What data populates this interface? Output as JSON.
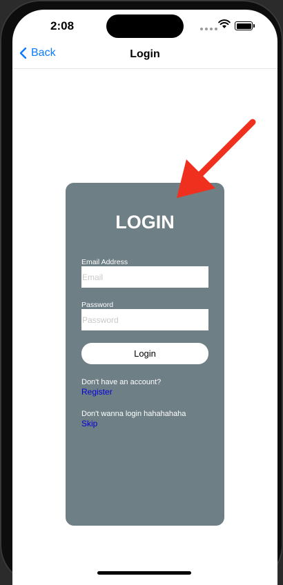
{
  "status_bar": {
    "time": "2:08"
  },
  "nav": {
    "back_label": "Back",
    "title": "Login"
  },
  "card": {
    "title": "LOGIN",
    "email": {
      "label": "Email Address",
      "placeholder": "Email",
      "value": ""
    },
    "password": {
      "label": "Password",
      "placeholder": "Password",
      "value": ""
    },
    "login_button": "Login",
    "register_prompt": "Don't have an account?",
    "register_link": "Register",
    "skip_prompt": "Don't wanna login hahahahaha",
    "skip_link": "Skip"
  },
  "colors": {
    "card_bg": "#6f7f86",
    "link": "#0000d8",
    "back": "#0a7aff",
    "annotation_arrow": "#f0301e"
  },
  "icons": [
    "chevron-left-icon",
    "wifi-icon",
    "battery-icon",
    "annotation-arrow-icon"
  ]
}
